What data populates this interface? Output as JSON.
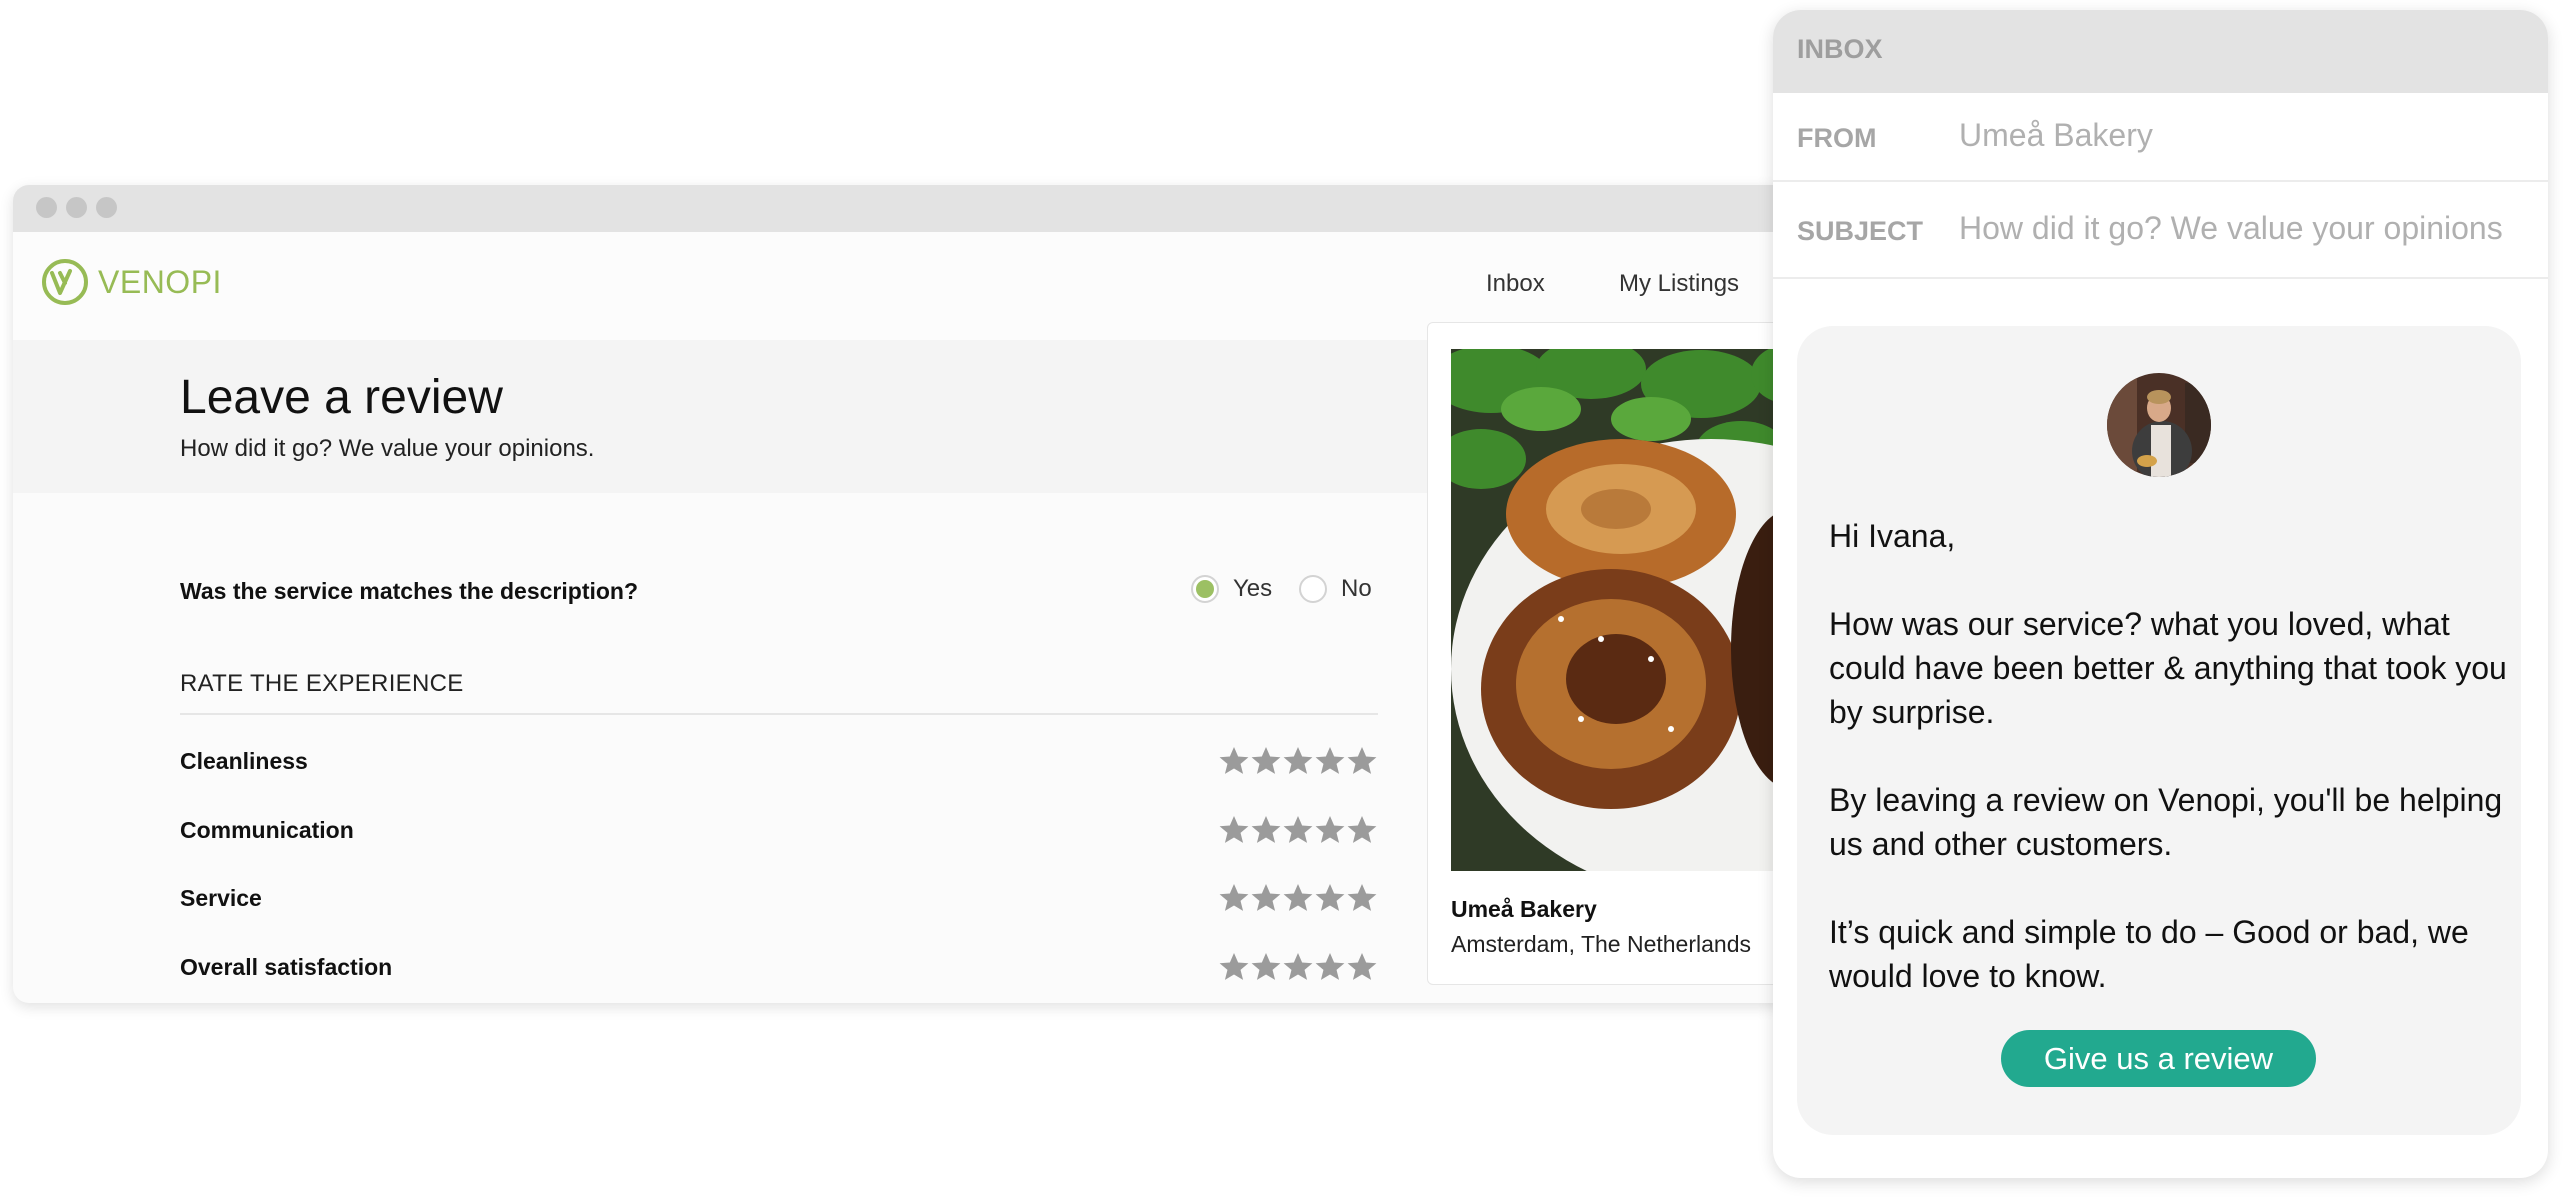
{
  "browser": {
    "logo_text": "VENOPI",
    "nav": [
      {
        "label": "Inbox"
      },
      {
        "label": "My Listings"
      }
    ],
    "page_title": "Leave a review",
    "page_subtitle": "How did it go? We value your opinions.",
    "question": {
      "label": "Was the service matches the description?",
      "options": [
        {
          "label": "Yes",
          "selected": true
        },
        {
          "label": "No",
          "selected": false
        }
      ]
    },
    "section_label": "RATE THE EXPERIENCE",
    "ratings": [
      {
        "label": "Cleanliness",
        "stars_filled": 0,
        "stars_total": 5
      },
      {
        "label": "Communication",
        "stars_filled": 0,
        "stars_total": 5
      },
      {
        "label": "Service",
        "stars_filled": 0,
        "stars_total": 5
      },
      {
        "label": "Overall satisfaction",
        "stars_filled": 0,
        "stars_total": 5
      }
    ],
    "listing": {
      "name": "Umeå Bakery",
      "location": "Amsterdam, The Netherlands",
      "image_desc": "braided cinnamon buns on a white plate with green leaves"
    }
  },
  "email": {
    "header_label": "INBOX",
    "from_label": "FROM",
    "from_value": "Umeå Bakery",
    "subject_label": "SUBJECT",
    "subject_value": "How did it go? We value your opinions",
    "greeting": "Hi Ivana,",
    "paragraphs": [
      "How was our service? what you loved, what could have been better & anything that took you by surprise.",
      "By leaving a review on Venopi, you'll be helping us and other customers.",
      "It’s quick and simple to do – Good or bad, we would love to know."
    ],
    "cta_label": "Give us a review"
  },
  "colors": {
    "brand_green": "#97bb55",
    "radio_selected": "#9cc063",
    "star_empty": "#9b9b9b",
    "cta": "#22a98f",
    "titlebar": "#e3e3e3"
  }
}
